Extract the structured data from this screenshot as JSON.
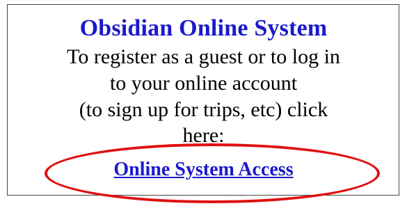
{
  "panel": {
    "title": "Obsidian Online System",
    "instructions": [
      "To register as a guest or to log in",
      "to your online account",
      "(to sign up for trips, etc) click",
      "here:"
    ],
    "link_label": "Online System Access"
  },
  "colors": {
    "title": "#1a1acc",
    "link": "#1a1acc",
    "highlight": "#e01010",
    "border": "#444444"
  }
}
